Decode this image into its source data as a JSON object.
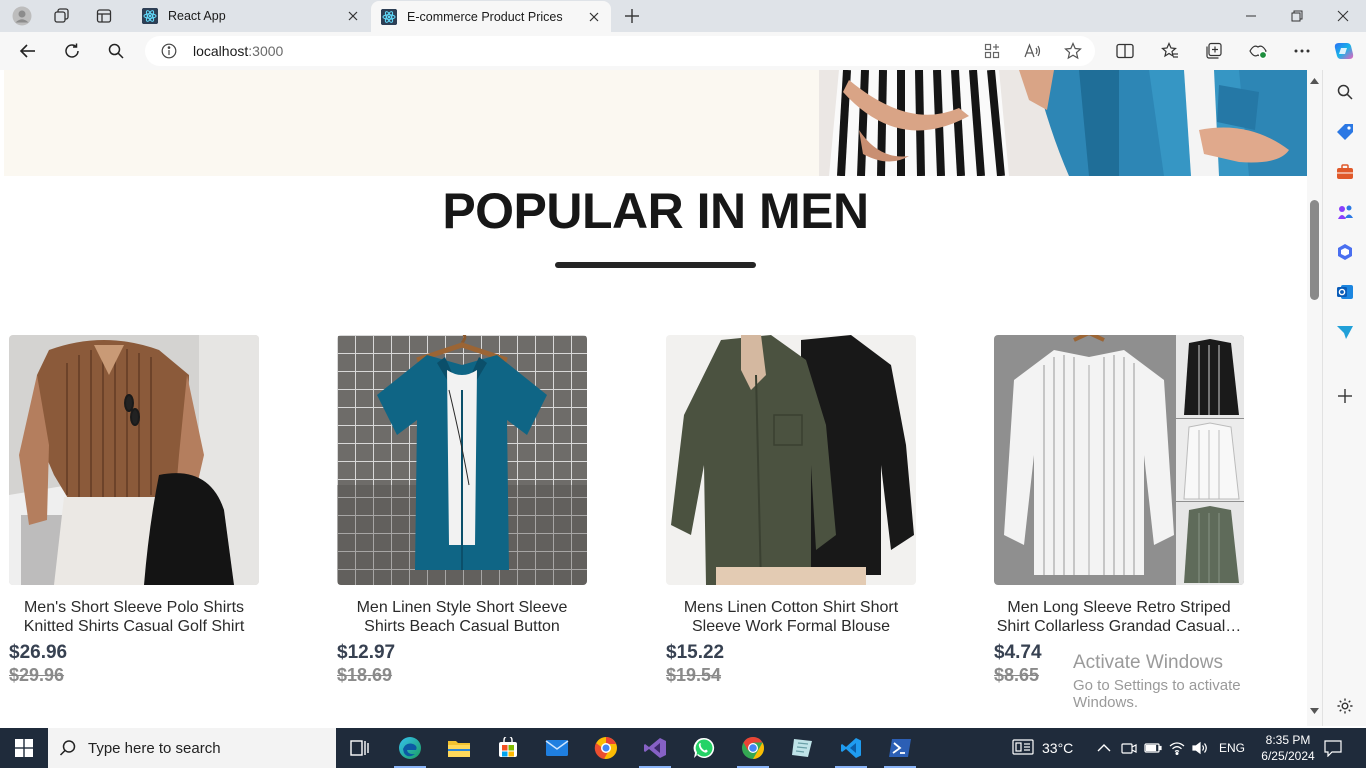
{
  "browser": {
    "tabs": [
      {
        "title": "React App",
        "active": false
      },
      {
        "title": "E-commerce Product Prices",
        "active": true
      }
    ],
    "address": {
      "host": "localhost",
      "port": ":3000"
    }
  },
  "page": {
    "section_title": "POPULAR IN MEN",
    "products": [
      {
        "name": "Men's Short Sleeve Polo Shirts Knitted Shirts Casual Golf Shirt",
        "new_price": "$26.96",
        "old_price": "$29.96"
      },
      {
        "name": "Men Linen Style Short Sleeve Shirts Beach Casual Button Down…",
        "new_price": "$12.97",
        "old_price": "$18.69"
      },
      {
        "name": "Mens Linen Cotton Shirt Short Sleeve Work Formal Blouse Butto…",
        "new_price": "$15.22",
        "old_price": "$19.54"
      },
      {
        "name": "Men Long Sleeve Retro Striped Shirt Collarless Grandad Casual…",
        "new_price": "$4.74",
        "old_price": "$8.65"
      }
    ],
    "watermark": {
      "line1": "Activate Windows",
      "line2": "Go to Settings to activate Windows."
    }
  },
  "taskbar": {
    "search_placeholder": "Type here to search",
    "weather": "33°C",
    "language": "ENG",
    "time": "8:35 PM",
    "date": "6/25/2024"
  },
  "colors": {
    "accent": "#0b5cad",
    "price": "#374151",
    "old_price": "#8a8a8a",
    "taskbar": "#1f2b3b"
  }
}
